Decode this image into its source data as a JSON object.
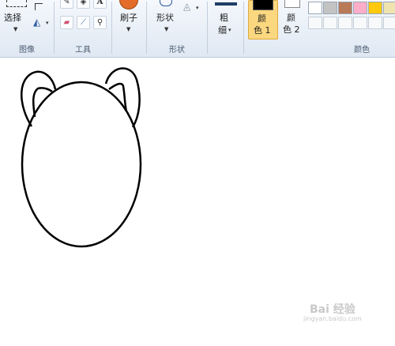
{
  "ribbon": {
    "image_group": {
      "label": "图像",
      "select_label": "选择"
    },
    "tools_group": {
      "label": "工具",
      "text_tool": "A"
    },
    "brush": {
      "label": "刷子"
    },
    "shapes_group": {
      "label": "形状",
      "shapes_button": "形状"
    },
    "size": {
      "label_line1": "粗",
      "label_line2": "细"
    },
    "color1": {
      "line1": "颜",
      "line2": "色 1",
      "color": "#000000"
    },
    "color2": {
      "line1": "颜",
      "line2": "色 2",
      "color": "#ffffff"
    },
    "colors_group": {
      "label": "颜色",
      "palette": [
        "#ffffff",
        "#c3c3c3",
        "#b97a57",
        "#ffaec9",
        "#ffc90e",
        "#efe4b0"
      ]
    }
  },
  "watermark": {
    "text": "Bai 经验",
    "url": "jingyan.baidu.com"
  }
}
